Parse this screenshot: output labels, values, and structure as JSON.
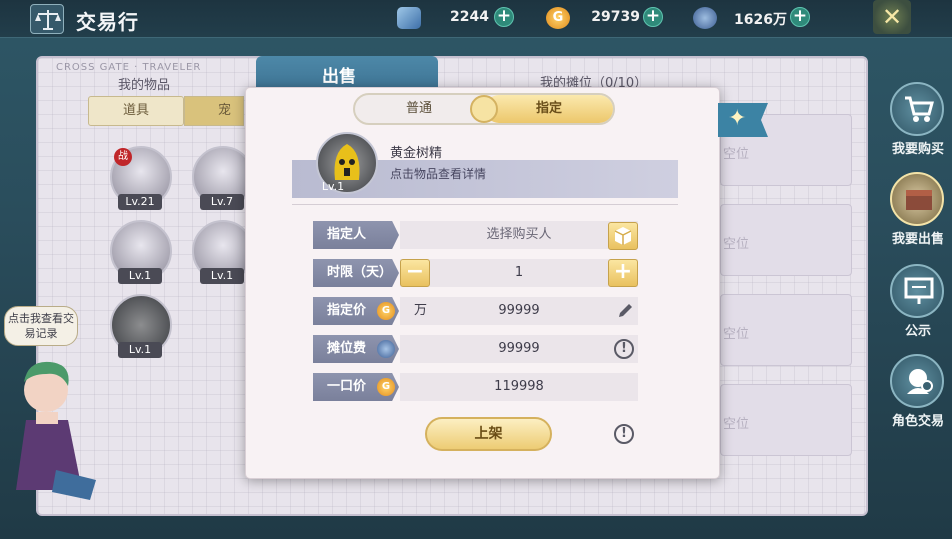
{
  "header": {
    "title": "交易行",
    "resources": [
      {
        "name": "gem",
        "value": "2244",
        "icon": "gem-icon"
      },
      {
        "name": "gold",
        "value": "29739",
        "icon": "gold-coin-icon",
        "glyph": "G"
      },
      {
        "name": "silver",
        "value": "1626万",
        "icon": "silver-coin-icon"
      }
    ],
    "close_glyph": "✕"
  },
  "board": {
    "brand": "CROSS GATE · TRAVELER",
    "left_title": "我的物品",
    "tabs": {
      "item": "道具",
      "pet": "宠物"
    },
    "slots": [
      {
        "level": "Lv.21",
        "tag": "战"
      },
      {
        "level": "Lv.7"
      },
      {
        "level": "Lv.1"
      },
      {
        "level": "Lv.1"
      },
      {
        "level": "Lv.1"
      }
    ],
    "right_title": "我的摊位（0/10）",
    "empty_label": "空位"
  },
  "sidebar": [
    {
      "label": "我要购买",
      "icon": "cart-icon"
    },
    {
      "label": "我要出售",
      "icon": "sell-box-icon"
    },
    {
      "label": "公示",
      "icon": "board-icon"
    },
    {
      "label": "角色交易",
      "icon": "character-icon"
    }
  ],
  "npc": {
    "bubble": "点击我查看交易记录"
  },
  "modal": {
    "tab_title": "出售",
    "segment": {
      "normal": "普通",
      "designated": "指定"
    },
    "item": {
      "name": "黄金树精",
      "hint": "点击物品查看详情",
      "level": "Lv.1"
    },
    "fields": {
      "designee_label": "指定人",
      "designee_placeholder": "选择购买人",
      "duration_label": "时限（天）",
      "duration_value": "1",
      "price_label": "指定价",
      "price_unit": "万",
      "price_value": "99999",
      "fee_label": "摊位费",
      "fee_value": "99999",
      "total_label": "一口价",
      "total_value": "119998"
    },
    "submit_label": "上架",
    "minus_glyph": "−",
    "plus_glyph": "+",
    "help_glyph": "!"
  }
}
